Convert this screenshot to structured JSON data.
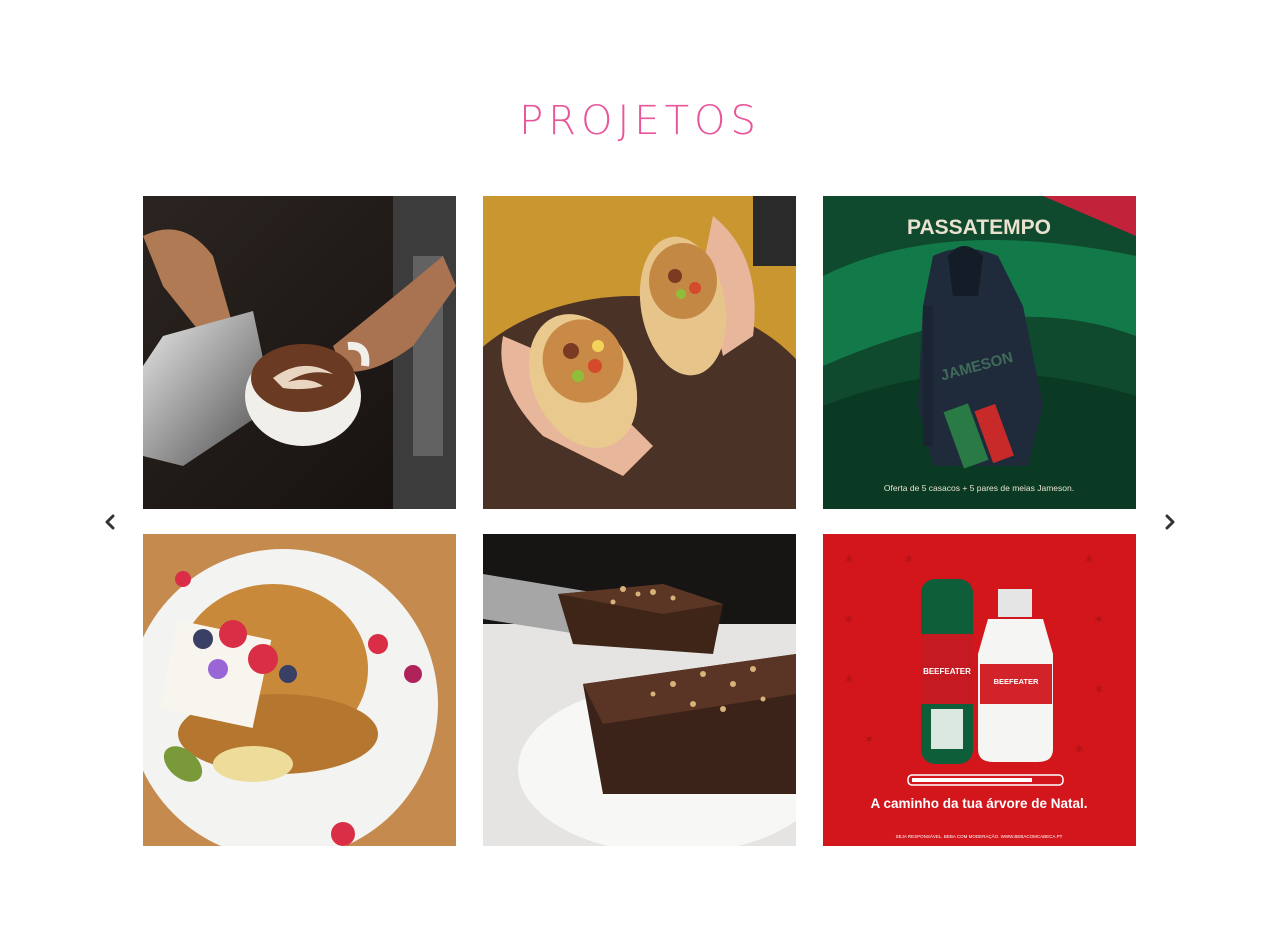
{
  "section": {
    "title": "PROJETOS",
    "title_color": "#e8559a"
  },
  "carousel": {
    "prev_icon": "chevron-left-icon",
    "next_icon": "chevron-right-icon",
    "arrow_color": "#333333",
    "tiles": [
      {
        "name": "latte-art-photo",
        "subject": "coffee latte art"
      },
      {
        "name": "burrito-photo",
        "subject": "burrito halves"
      },
      {
        "name": "jameson-giveaway-poster",
        "subject": "Jameson hoodie and socks",
        "heading": "PASSATEMPO",
        "brand_text": "JAMESON",
        "caption": "Oferta de 5 casacos + 5 pares de meias Jameson."
      },
      {
        "name": "pancakes-photo",
        "subject": "pancakes with berries"
      },
      {
        "name": "chocolate-cake-photo",
        "subject": "chocolate cake slice"
      },
      {
        "name": "beefeater-christmas-poster",
        "subject": "Beefeater gin bottle",
        "brand_text": "BEEFEATER",
        "caption": "A caminho da tua árvore de Natal.",
        "disclaimer": "SEJA RESPONSÁVEL. BEBA COM MODERAÇÃO. WWW.BEBACOMCABECA.PT"
      }
    ]
  }
}
